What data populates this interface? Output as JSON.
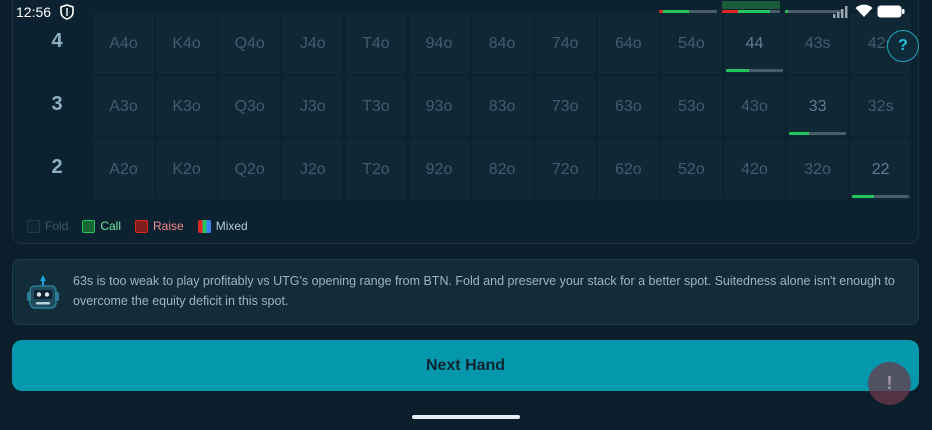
{
  "status_bar": {
    "time": "12:56",
    "icons": [
      "shield-icon",
      "signal-icon",
      "wifi-icon",
      "battery-icon"
    ]
  },
  "grid": {
    "rows": [
      {
        "label": "4",
        "cells": [
          "A4o",
          "K4o",
          "Q4o",
          "J4o",
          "T4o",
          "94o",
          "84o",
          "74o",
          "64o",
          "54o",
          "44",
          "43s",
          "42s"
        ]
      },
      {
        "label": "3",
        "cells": [
          "A3o",
          "K3o",
          "Q3o",
          "J3o",
          "T3o",
          "93o",
          "83o",
          "73o",
          "63o",
          "53o",
          "43o",
          "33",
          "32s"
        ]
      },
      {
        "label": "2",
        "cells": [
          "A2o",
          "K2o",
          "Q2o",
          "J2o",
          "T2o",
          "92o",
          "82o",
          "72o",
          "62o",
          "52o",
          "42o",
          "32o",
          "22"
        ]
      }
    ],
    "frequencies": {
      "44": {
        "call": 0.4
      },
      "33": {
        "call": 0.35
      },
      "22": {
        "call": 0.38
      }
    }
  },
  "legend": {
    "fold": "Fold",
    "call": "Call",
    "raise": "Raise",
    "mixed": "Mixed"
  },
  "colors": {
    "fold": "#1a3342",
    "call": "#22c55e",
    "raise": "#dc2626",
    "accent": "#0598ac"
  },
  "help_label": "?",
  "explanation": "63s is too weak to play profitably vs UTG's opening range from BTN. Fold and preserve your stack for a better spot. Suitedness alone isn't enough to overcome the equity deficit in this spot.",
  "next_hand_label": "Next Hand",
  "feedback_label": "!"
}
